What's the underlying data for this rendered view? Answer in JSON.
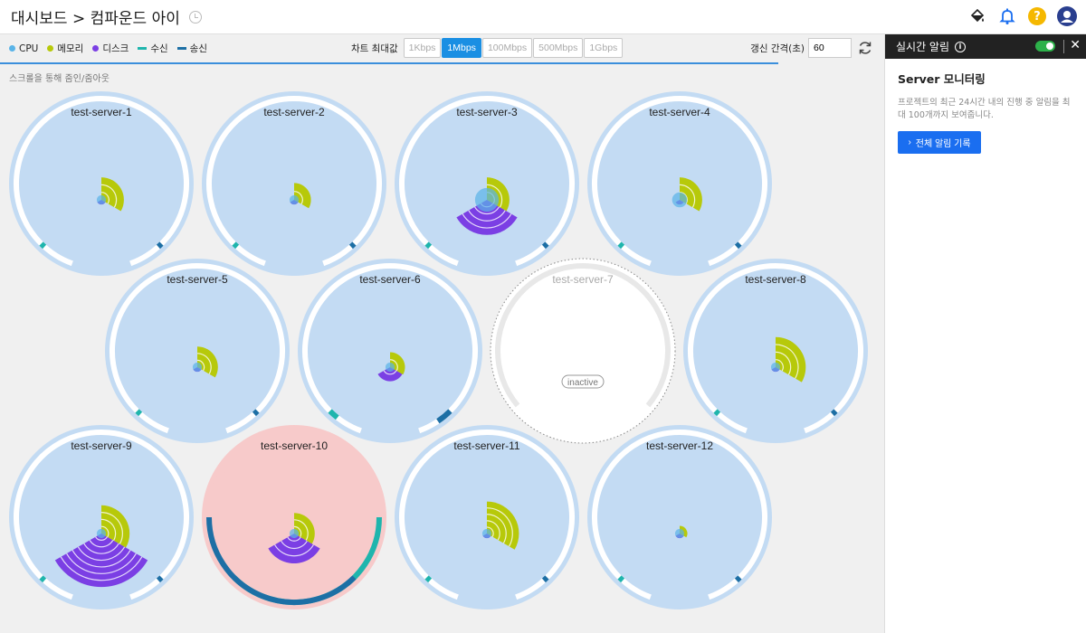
{
  "header": {
    "title": "대시보드 > 컴파운드 아이",
    "icons": [
      "history-icon",
      "paint-bucket-icon",
      "bell-icon",
      "help-icon",
      "avatar"
    ]
  },
  "legend": [
    {
      "label": "CPU",
      "color": "#5ab4e8",
      "shape": "dot"
    },
    {
      "label": "메모리",
      "color": "#b7c90a",
      "shape": "dot"
    },
    {
      "label": "디스크",
      "color": "#7b3fe4",
      "shape": "dot"
    },
    {
      "label": "수신",
      "color": "#1fb5ad",
      "shape": "dash"
    },
    {
      "label": "송신",
      "color": "#1d6fa5",
      "shape": "dash"
    }
  ],
  "chart_max": {
    "label": "차트 최대값",
    "options": [
      "1Kbps",
      "1Mbps",
      "100Mbps",
      "500Mbps",
      "1Gbps"
    ],
    "selected": "1Mbps"
  },
  "refresh": {
    "label": "갱신 간격(초)",
    "value": "60"
  },
  "refresh_progress": 0.88,
  "hint": "스크롤을 통해 줌인/줌아웃",
  "servers": [
    {
      "name": "test-server-1",
      "status": "active",
      "cpu": 0.02,
      "mem": 0.45,
      "disk": 0.02,
      "rx": 0.02,
      "tx": 0.02,
      "alert": false
    },
    {
      "name": "test-server-2",
      "status": "active",
      "cpu": 0.02,
      "mem": 0.3,
      "disk": 0.02,
      "rx": 0.02,
      "tx": 0.02,
      "alert": false
    },
    {
      "name": "test-server-3",
      "status": "active",
      "cpu": 0.12,
      "mem": 0.45,
      "disk": 0.6,
      "rx": 0.02,
      "tx": 0.02,
      "alert": false
    },
    {
      "name": "test-server-4",
      "status": "active",
      "cpu": 0.06,
      "mem": 0.45,
      "disk": 0.02,
      "rx": 0.02,
      "tx": 0.02,
      "alert": false
    },
    {
      "name": "test-server-5",
      "status": "active",
      "cpu": 0.02,
      "mem": 0.4,
      "disk": 0.02,
      "rx": 0.02,
      "tx": 0.02,
      "alert": false
    },
    {
      "name": "test-server-6",
      "status": "active",
      "cpu": 0.02,
      "mem": 0.25,
      "disk": 0.2,
      "rx": 0.05,
      "tx": 0.08,
      "alert": false
    },
    {
      "name": "test-server-7",
      "status": "inactive",
      "badge": "inactive"
    },
    {
      "name": "test-server-8",
      "status": "active",
      "cpu": 0.02,
      "mem": 0.65,
      "disk": 0.02,
      "rx": 0.02,
      "tx": 0.02,
      "alert": false
    },
    {
      "name": "test-server-9",
      "status": "active",
      "cpu": 0.02,
      "mem": 0.6,
      "disk": 0.95,
      "rx": 0.02,
      "tx": 0.02,
      "alert": false
    },
    {
      "name": "test-server-10",
      "status": "active",
      "cpu": 0.02,
      "mem": 0.4,
      "disk": 0.5,
      "rx": 1.0,
      "tx": 1.0,
      "alert": true
    },
    {
      "name": "test-server-11",
      "status": "active",
      "cpu": 0.02,
      "mem": 0.7,
      "disk": 0.02,
      "rx": 0.02,
      "tx": 0.02,
      "alert": false
    },
    {
      "name": "test-server-12",
      "status": "active",
      "cpu": 0.02,
      "mem": 0.06,
      "disk": 0.02,
      "rx": 0.02,
      "tx": 0.02,
      "alert": false
    }
  ],
  "sidepanel": {
    "title": "실시간 알림",
    "toggle_on": true,
    "section_title": "Server 모니터링",
    "description": "프로젝트의 최근 24시간 내의 진행 중 알림을 최대 100개까지 보여줍니다.",
    "button_label": "전체 알림 기록"
  }
}
